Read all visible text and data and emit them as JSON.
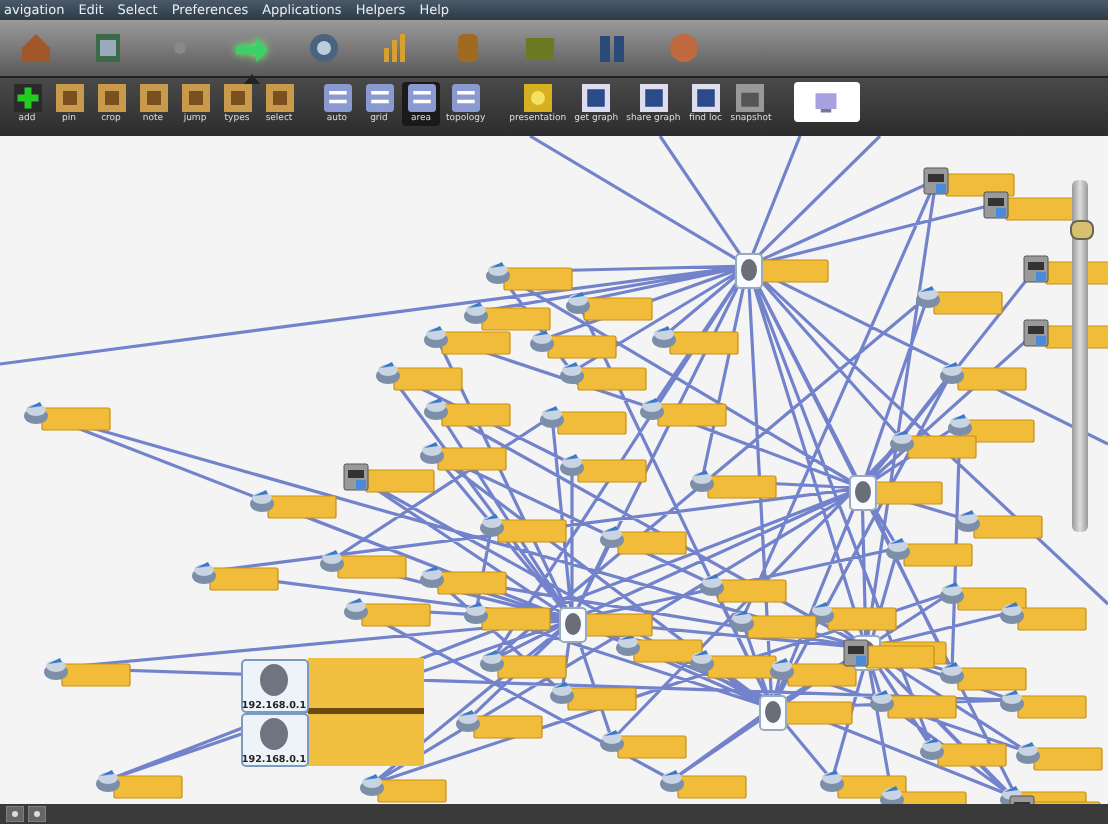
{
  "menu_bar": [
    "avigation",
    "Edit",
    "Select",
    "Preferences",
    "Applications",
    "Helpers",
    "Help"
  ],
  "nav_icons": [
    {
      "selected": false
    },
    {
      "selected": false
    },
    {
      "selected": false
    },
    {
      "selected": true
    },
    {
      "selected": false
    },
    {
      "selected": false
    },
    {
      "selected": false
    },
    {
      "selected": false
    },
    {
      "selected": false
    },
    {
      "selected": false
    }
  ],
  "toolbar": [
    {
      "label": "add",
      "selected": false
    },
    {
      "label": "pin",
      "selected": false
    },
    {
      "label": "crop",
      "selected": false
    },
    {
      "label": "note",
      "selected": false
    },
    {
      "label": "jump",
      "selected": false
    },
    {
      "label": "types",
      "selected": false
    },
    {
      "label": "select",
      "selected": false
    },
    {
      "label": "auto",
      "selected": false
    },
    {
      "label": "grid",
      "selected": false
    },
    {
      "label": "area",
      "selected": true
    },
    {
      "label": "topology",
      "selected": false
    },
    {
      "label": "presentation",
      "selected": false
    },
    {
      "label": "get graph",
      "selected": false
    },
    {
      "label": "share graph",
      "selected": false
    },
    {
      "label": "find loc",
      "selected": false
    },
    {
      "label": "snapshot",
      "selected": false
    },
    {
      "selected": true
    }
  ],
  "graph": {
    "nodes": [
      {
        "kind": "router"
      },
      {
        "kind": "router"
      },
      {
        "kind": "router"
      },
      {
        "kind": "router"
      },
      {
        "kind": "router"
      },
      {
        "kind": "router"
      },
      {
        "kind": "router"
      },
      {
        "kind": "router"
      },
      {
        "kind": "router"
      },
      {
        "kind": "router"
      },
      {
        "kind": "router"
      },
      {
        "kind": "router"
      },
      {
        "kind": "router"
      },
      {
        "kind": "router"
      },
      {
        "kind": "router"
      },
      {
        "kind": "router"
      },
      {
        "kind": "router"
      },
      {
        "kind": "router"
      },
      {
        "kind": "router"
      },
      {
        "kind": "router"
      },
      {
        "kind": "router"
      },
      {
        "kind": "router"
      },
      {
        "kind": "router"
      },
      {
        "kind": "router"
      },
      {
        "kind": "router"
      },
      {
        "kind": "router"
      },
      {
        "kind": "router"
      },
      {
        "kind": "router"
      },
      {
        "kind": "router"
      },
      {
        "kind": "router"
      },
      {
        "kind": "router"
      },
      {
        "kind": "router"
      },
      {
        "kind": "router"
      },
      {
        "kind": "router"
      },
      {
        "kind": "router"
      },
      {
        "kind": "router"
      },
      {
        "kind": "router"
      },
      {
        "kind": "router"
      },
      {
        "kind": "router"
      },
      {
        "kind": "router"
      },
      {
        "kind": "router"
      },
      {
        "kind": "router"
      },
      {
        "kind": "router"
      },
      {
        "kind": "router"
      },
      {
        "kind": "router"
      },
      {
        "kind": "router"
      },
      {
        "kind": "router"
      },
      {
        "kind": "router"
      },
      {
        "kind": "router"
      },
      {
        "kind": "router"
      },
      {
        "kind": "router"
      },
      {
        "kind": "router"
      },
      {
        "kind": "router"
      },
      {
        "kind": "hub"
      },
      {
        "kind": "hub"
      },
      {
        "kind": "hub"
      },
      {
        "kind": "hub"
      },
      {
        "kind": "hub"
      },
      {
        "kind": "server"
      },
      {
        "kind": "server"
      },
      {
        "kind": "server"
      },
      {
        "kind": "server"
      },
      {
        "kind": "server"
      },
      {
        "kind": "server"
      },
      {
        "kind": "server"
      }
    ],
    "selected_node": {
      "labels": [
        "192.168.0.1",
        "192.168.0.1"
      ]
    }
  },
  "zoom_slider": {
    "level": 0.88
  }
}
